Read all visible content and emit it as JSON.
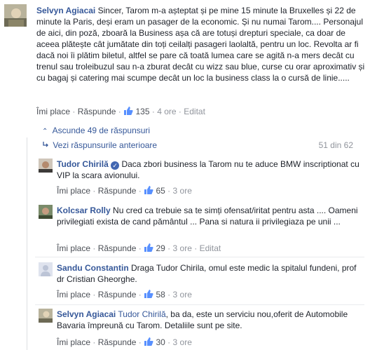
{
  "main_comment": {
    "author": "Selvyn Agiacai",
    "text": "Sincer, Tarom m-a așteptat și pe mine 15 minute la Bruxelles și 22 de minute la Paris, deși eram un pasager de la economic. Și nu numai Tarom.... Personajul de aici, din poză, zboară la Business așa că are totuși drepturi speciale, ca doar de aceea plătește cât jumătate din toți ceilalți pasageri laolaltă, pentru un loc. Revolta ar fi dacă noi îi plătim biletul, altfel se pare că toată lumea care se agită n-a mers decât cu trenul sau troleibuzul sau n-a zburat decât cu wizz sau blue, curse cu orar aproximativ și cu bagaj și catering mai scumpe decât un loc la business class la o cursă de linie.....",
    "like_label": "Îmi place",
    "reply_label": "Răspunde",
    "likes": "135",
    "time": "4 ore",
    "edited": "Editat"
  },
  "thread": {
    "hide_replies": "Ascunde 49 de răspunsuri",
    "previous_replies": "Vezi răspunsurile anterioare",
    "counter": "51 din 62"
  },
  "replies": [
    {
      "author": "Tudor Chirilă",
      "verified": true,
      "text": "Daca zbori business la Tarom nu te aduce BMW inscriptionat cu VIP la scara avionului.",
      "like_label": "Îmi place",
      "reply_label": "Răspunde",
      "likes": "65",
      "time": "3 ore",
      "edited": ""
    },
    {
      "author": "Kolcsar Rolly",
      "verified": false,
      "text": "Nu cred ca trebuie sa te simți ofensat/iritat pentru asta .... Oameni privilegiati exista de cand pământul ... Pana si natura ii privilegiaza pe unii ...",
      "like_label": "Îmi place",
      "reply_label": "Răspunde",
      "likes": "29",
      "time": "3 ore",
      "edited": "Editat"
    },
    {
      "author": "Sandu Constantin",
      "verified": false,
      "text": "Draga Tudor Chirila, omul este medic la spitalul fundeni, prof dr Cristian Gheorghe.",
      "like_label": "Îmi place",
      "reply_label": "Răspunde",
      "likes": "58",
      "time": "3 ore",
      "edited": ""
    },
    {
      "author": "Selvyn Agiacai",
      "verified": false,
      "mention": "Tudor Chirilă",
      "text": ", ba da, este un serviciu nou,oferit de Automobile Bavaria împreună cu Tarom. Detaliile sunt pe site.",
      "like_label": "Îmi place",
      "reply_label": "Răspunde",
      "likes": "30",
      "time": "3 ore",
      "edited": ""
    }
  ],
  "colors": {
    "link": "#365899",
    "muted": "#90949c",
    "thumb": "#5890ff",
    "verified": "#4267b2"
  },
  "icons": {
    "thumb": "thumbs-up-icon",
    "hide": "chevron-up-icon",
    "previous": "reply-arrow-icon",
    "verified": "verified-badge-icon"
  }
}
